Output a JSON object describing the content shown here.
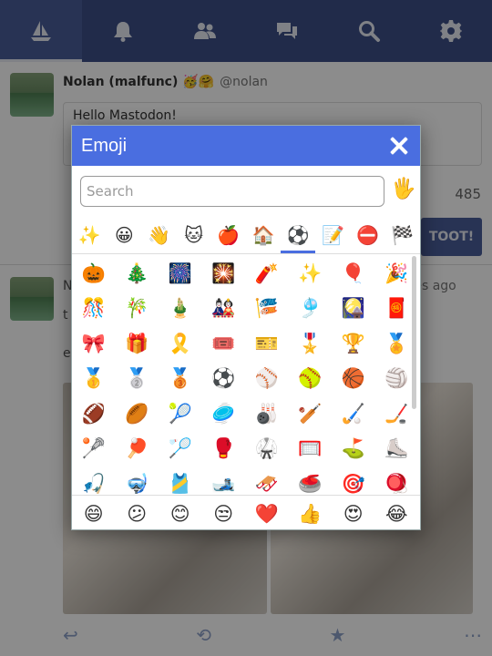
{
  "nav": {
    "tabs": [
      {
        "icon": "sailboat-icon",
        "active": true
      },
      {
        "icon": "bell-icon",
        "active": false
      },
      {
        "icon": "users-icon",
        "active": false
      },
      {
        "icon": "comments-icon",
        "active": false
      },
      {
        "icon": "search-icon",
        "active": false
      },
      {
        "icon": "gear-icon",
        "active": false
      }
    ]
  },
  "compose": {
    "display_name": "Nolan (malfunc) 🥳🤗",
    "handle": "@nolan",
    "text": "Hello Mastodon!",
    "char_count": "485",
    "toot_label": "TOOT!"
  },
  "timeline": {
    "first_letter": "N",
    "time_fragment": "utes ago",
    "second_letter": "t",
    "third_letter": "e"
  },
  "modal": {
    "title": "Emoji",
    "search_placeholder": "Search",
    "skin_tone": "🖐️",
    "categories": [
      "✨",
      "😀",
      "👋",
      "🐱",
      "🍎",
      "🏠",
      "⚽",
      "📝",
      "⛔",
      "🏁"
    ],
    "active_category": 6,
    "emojis": [
      "🎃",
      "🎄",
      "🎆",
      "🎇",
      "🧨",
      "✨",
      "🎈",
      "🎉",
      "🎊",
      "🎋",
      "🎍",
      "🎎",
      "🎏",
      "🎐",
      "🎑",
      "🧧",
      "🎀",
      "🎁",
      "🎗️",
      "🎟️",
      "🎫",
      "🎖️",
      "🏆",
      "🏅",
      "🥇",
      "🥈",
      "🥉",
      "⚽",
      "⚾",
      "🥎",
      "🏀",
      "🏐",
      "🏈",
      "🏉",
      "🎾",
      "🥏",
      "🎳",
      "🏏",
      "🏑",
      "🏒",
      "🥍",
      "🏓",
      "🏸",
      "🥊",
      "🥋",
      "🥅",
      "⛳",
      "⛸️",
      "🎣",
      "🤿",
      "🎽",
      "🎿",
      "🛷",
      "🥌",
      "🎯",
      "🪀"
    ],
    "frequent": [
      "😄",
      "😕",
      "😊",
      "😒",
      "❤️",
      "👍",
      "😍",
      "😂"
    ]
  },
  "colors": {
    "nav_bg": "#3d4f87",
    "modal_header": "#4a6ee0",
    "toot_button": "#4a5d99"
  }
}
